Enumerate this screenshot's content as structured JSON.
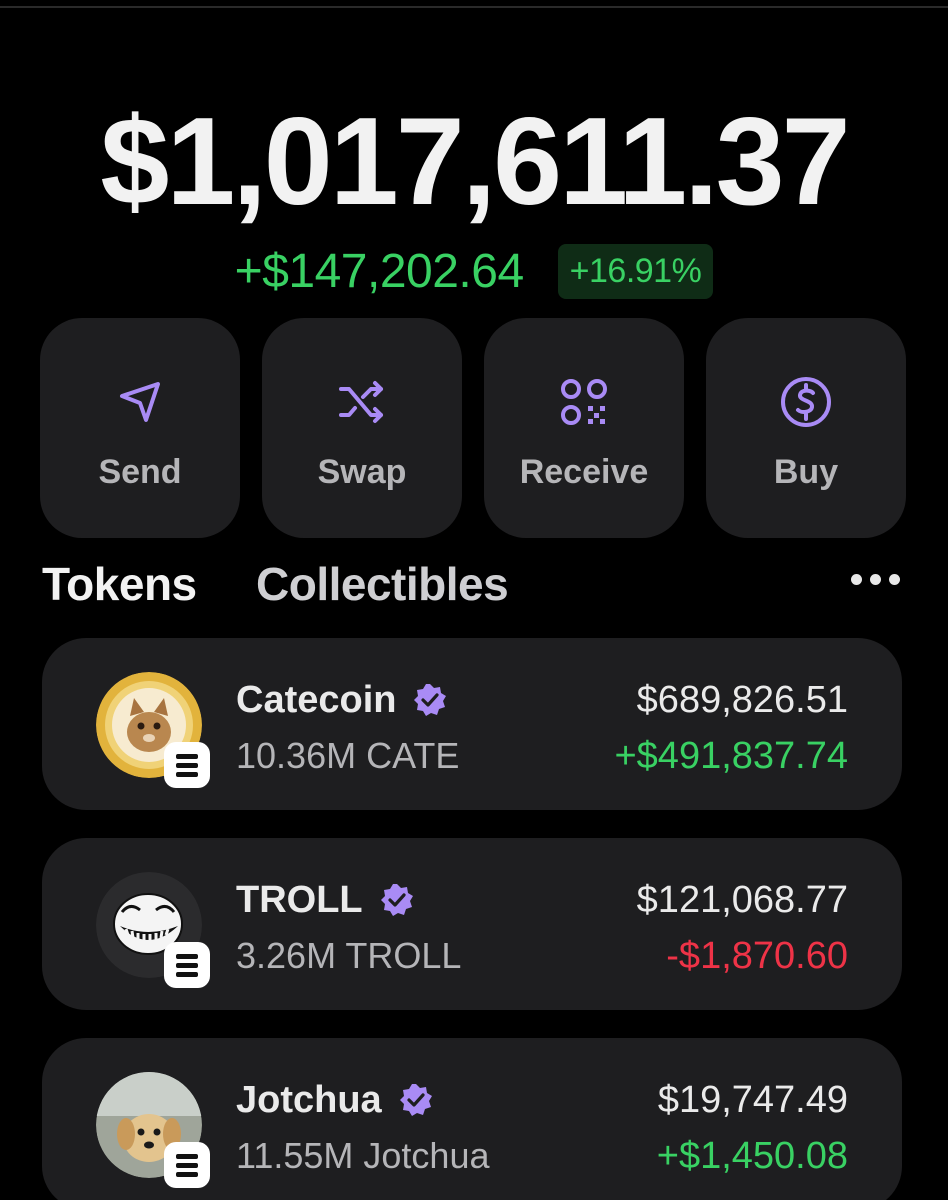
{
  "portfolio": {
    "balance": "$1,017,611.37",
    "change_amount": "+$147,202.64",
    "change_percent": "+16.91%",
    "positive_color": "#39d163",
    "negative_color": "#ee3347",
    "accent_color": "#a98bf5"
  },
  "actions": [
    {
      "label": "Send",
      "icon": "send-icon"
    },
    {
      "label": "Swap",
      "icon": "swap-icon"
    },
    {
      "label": "Receive",
      "icon": "qr-code-icon"
    },
    {
      "label": "Buy",
      "icon": "dollar-circle-icon"
    }
  ],
  "tabs": {
    "tokens": "Tokens",
    "collectibles": "Collectibles",
    "active": "Tokens",
    "more_icon": "more-horizontal-icon"
  },
  "tokens": [
    {
      "name": "Catecoin",
      "quantity": "10.36M CATE",
      "value": "$689,826.51",
      "change": "+$491,837.74",
      "trend": "up",
      "verified": true,
      "chain": "solana"
    },
    {
      "name": "TROLL",
      "quantity": "3.26M TROLL",
      "value": "$121,068.77",
      "change": "-$1,870.60",
      "trend": "down",
      "verified": true,
      "chain": "solana"
    },
    {
      "name": "Jotchua",
      "quantity": "11.55M Jotchua",
      "value": "$19,747.49",
      "change": "+$1,450.08",
      "trend": "up",
      "verified": true,
      "chain": "solana"
    }
  ]
}
